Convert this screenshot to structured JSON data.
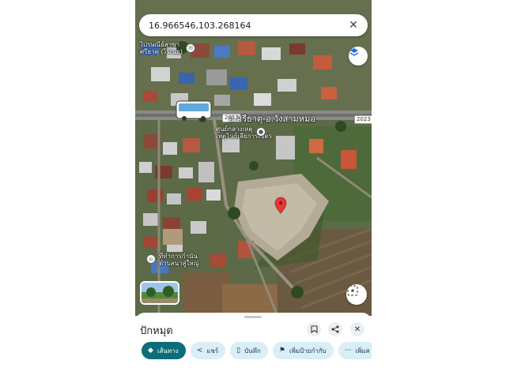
{
  "search": {
    "query": "16.966546,103.268164",
    "clear_icon": "close-icon"
  },
  "map": {
    "road_label": "อ.ศรีธาตุ-อ.วังสามหมอ",
    "route_shield": "2023",
    "poi_top_left": [
      "ไปรษณีย์สาขา",
      "ศรีธาตุ (ไร่เนย)"
    ],
    "poi_center": [
      "ศูนย์กลางเหตุ",
      "เหตุไนย์เลียการเขตร"
    ],
    "poi_bottom_left": [
      "ที่ทำการกำนัน",
      "ตำบลนาสู่ใหญ่"
    ],
    "marker_color": "#e53935"
  },
  "sheet": {
    "place_name": "ปักหมุด",
    "chips": {
      "directions": "เส้นทาง",
      "share": "แชร์",
      "save": "บันทึก",
      "label": "เพิ่มป้ายกำกับ",
      "more": "เพิ่มส"
    }
  },
  "colors": {
    "primary_chip": "#0b6e79",
    "secondary_chip": "#d9eef6"
  }
}
